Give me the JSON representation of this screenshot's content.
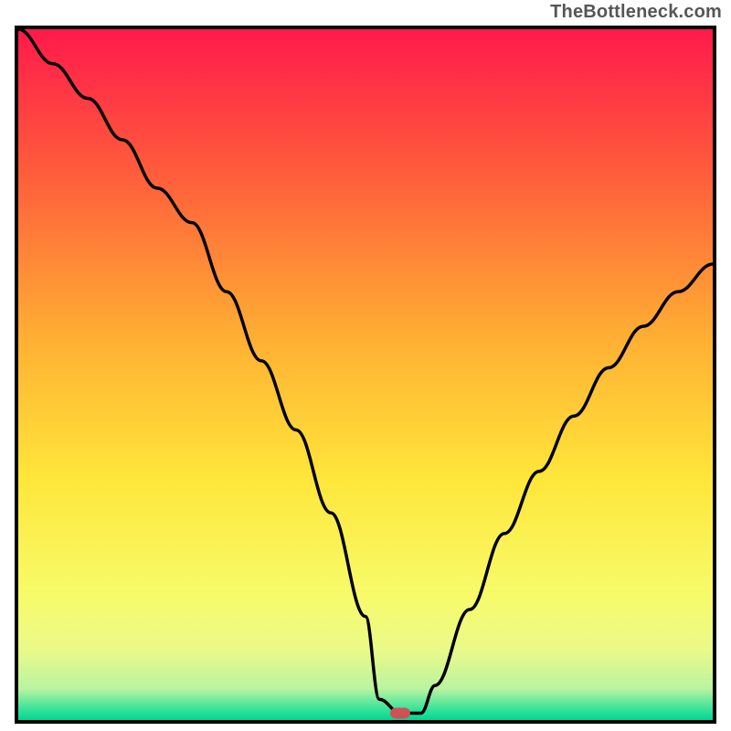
{
  "attribution": "TheBottleneck.com",
  "chart_data": {
    "type": "line",
    "title": "",
    "xlabel": "",
    "ylabel": "",
    "xlim": [
      0,
      100
    ],
    "ylim": [
      0,
      100
    ],
    "grid": false,
    "series": [
      {
        "name": "curve",
        "x": [
          0,
          5,
          10,
          15,
          20,
          25,
          30,
          35,
          40,
          45,
          50,
          52,
          55,
          58,
          60,
          65,
          70,
          75,
          80,
          85,
          90,
          95,
          100
        ],
        "values": [
          100,
          95,
          90,
          84,
          77,
          72,
          62,
          52,
          42,
          30,
          15,
          3,
          1,
          1,
          5,
          16,
          27,
          36,
          44,
          51,
          57,
          62,
          66
        ]
      }
    ],
    "marker": {
      "x": 55,
      "y": 1,
      "color": "#d05058"
    },
    "gradient_stops": [
      {
        "offset": 0.0,
        "color": "#ff1a4b"
      },
      {
        "offset": 0.2,
        "color": "#ff5a3c"
      },
      {
        "offset": 0.45,
        "color": "#ffb033"
      },
      {
        "offset": 0.65,
        "color": "#ffe63a"
      },
      {
        "offset": 0.82,
        "color": "#f7fb6a"
      },
      {
        "offset": 0.9,
        "color": "#eaf98a"
      },
      {
        "offset": 0.955,
        "color": "#b9f4a0"
      },
      {
        "offset": 0.985,
        "color": "#35e29a"
      },
      {
        "offset": 1.0,
        "color": "#00d890"
      }
    ]
  }
}
